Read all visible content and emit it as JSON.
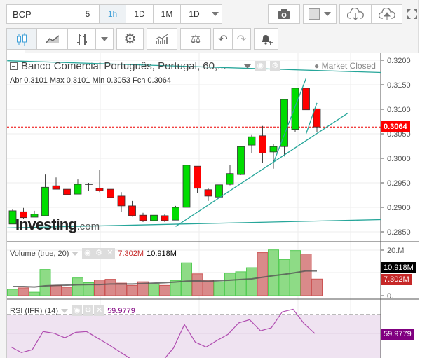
{
  "toolbar": {
    "symbol": "BCP",
    "intervals": [
      {
        "label": "5",
        "active": false
      },
      {
        "label": "1h",
        "active": true
      },
      {
        "label": "1D",
        "active": false
      },
      {
        "label": "1M",
        "active": false
      },
      {
        "label": "1D",
        "active": false
      }
    ],
    "icons": [
      "camera-icon",
      "color-picker-icon",
      "cloud-download-icon",
      "cloud-upload-icon",
      "fullscreen-icon",
      "candlestick-icon",
      "line-chart-icon",
      "bars-icon",
      "gear-icon",
      "indicators-icon",
      "scale-icon",
      "undo-icon",
      "redo-icon",
      "add-alert-icon"
    ]
  },
  "legend": {
    "title": "Banco Comercial Português, Portugal, 60,...",
    "market_status": "Market Closed",
    "ohlc": [
      {
        "k": "Abr",
        "v": "0.3101"
      },
      {
        "k": "Max",
        "v": "0.3101"
      },
      {
        "k": "Min",
        "v": "0.3053"
      },
      {
        "k": "Fch",
        "v": "0.3064"
      }
    ]
  },
  "watermark": {
    "brand": "Investing",
    "suffix": ".com"
  },
  "volume": {
    "label": "Volume (true, 20)",
    "value": "7.302M",
    "ma_value": "10.918M"
  },
  "rsi": {
    "label": "RSI (IFR) (14)",
    "value": "59.9779"
  },
  "colors": {
    "up": "#00dd00",
    "down": "#ff0000",
    "trend": "#26a69a",
    "rsi": "#b04cb0",
    "vol_up": "#8edb86",
    "vol_down": "#d98a8a"
  },
  "chart_data": {
    "type": "candlestick",
    "price_axis": {
      "ticks": [
        "0.3200",
        "0.3150",
        "0.3100",
        "0.3050",
        "0.3000",
        "0.2950",
        "0.2900",
        "0.2850"
      ],
      "range": [
        0.2835,
        0.3215
      ]
    },
    "last_price": "0.3064",
    "candles": [
      [
        0.2866,
        0.2897,
        0.2866,
        0.2893
      ],
      [
        0.2891,
        0.2899,
        0.2876,
        0.2879
      ],
      [
        0.288,
        0.2893,
        0.288,
        0.2886
      ],
      [
        0.2883,
        0.2967,
        0.2883,
        0.2941
      ],
      [
        0.2944,
        0.2961,
        0.2937,
        0.2937
      ],
      [
        0.2937,
        0.2954,
        0.2926,
        0.2926
      ],
      [
        0.2927,
        0.2957,
        0.2927,
        0.2947
      ],
      [
        0.2947,
        0.295,
        0.2934,
        0.2948
      ],
      [
        0.2939,
        0.2977,
        0.2931,
        0.2934
      ],
      [
        0.2937,
        0.2937,
        0.292,
        0.292
      ],
      [
        0.2923,
        0.2931,
        0.289,
        0.2903
      ],
      [
        0.2903,
        0.2913,
        0.2881,
        0.2883
      ],
      [
        0.2884,
        0.2889,
        0.287,
        0.2873
      ],
      [
        0.2873,
        0.2889,
        0.2856,
        0.2884
      ],
      [
        0.2883,
        0.2887,
        0.287,
        0.2873
      ],
      [
        0.2874,
        0.2903,
        0.2874,
        0.29
      ],
      [
        0.29,
        0.2986,
        0.29,
        0.2986
      ],
      [
        0.2984,
        0.2984,
        0.293,
        0.2939
      ],
      [
        0.2936,
        0.294,
        0.2913,
        0.2923
      ],
      [
        0.2921,
        0.2949,
        0.2911,
        0.2946
      ],
      [
        0.2947,
        0.2986,
        0.2945,
        0.2969
      ],
      [
        0.2967,
        0.3024,
        0.2966,
        0.3024
      ],
      [
        0.3027,
        0.3049,
        0.301,
        0.3044
      ],
      [
        0.3046,
        0.3066,
        0.2991,
        0.3011
      ],
      [
        0.3013,
        0.303,
        0.2979,
        0.3024
      ],
      [
        0.3024,
        0.312,
        0.3004,
        0.312
      ],
      [
        0.3059,
        0.3143,
        0.3053,
        0.3143
      ],
      [
        0.3143,
        0.3174,
        0.3063,
        0.3099
      ],
      [
        0.3101,
        0.3101,
        0.3053,
        0.3064
      ]
    ],
    "trendlines": [
      [
        [
          -0.5,
          0.3199
        ],
        [
          33.9,
          0.3175
        ]
      ],
      [
        [
          -0.5,
          0.2858
        ],
        [
          33.9,
          0.2875
        ]
      ],
      [
        [
          15,
          0.2861
        ],
        [
          30.9,
          0.3093
        ]
      ],
      [
        [
          24,
          0.2991
        ],
        [
          27,
          0.3163
        ]
      ],
      [
        [
          27,
          0.305
        ],
        [
          28,
          0.3113
        ]
      ]
    ],
    "volume_axis": {
      "ticks": [
        "20.M",
        "0."
      ],
      "range": [
        0,
        20
      ]
    },
    "volume_millions": [
      2.8,
      3.4,
      1.5,
      11.5,
      4.5,
      3.7,
      7.8,
      5.7,
      6.9,
      7.2,
      5.5,
      4.5,
      6.1,
      5.2,
      4.5,
      6.7,
      14.4,
      9.6,
      6.9,
      6.1,
      9.9,
      10.5,
      12.3,
      18.9,
      20.1,
      15.9,
      19.8,
      18.3,
      7.3
    ],
    "volume_ma_millions": [
      4.0,
      4.0,
      3.8,
      4.3,
      4.5,
      4.6,
      4.8,
      4.9,
      4.9,
      5.1,
      5.1,
      5.1,
      5.3,
      5.5,
      5.7,
      6.0,
      6.4,
      6.5,
      6.3,
      6.6,
      6.8,
      7.1,
      7.4,
      8.1,
      8.8,
      9.4,
      10.1,
      10.9,
      10.9
    ],
    "rsi_values": [
      53.0,
      49.9,
      51.4,
      61.0,
      60.1,
      57.7,
      60.6,
      61.0,
      57.6,
      54.2,
      50.5,
      46.8,
      43.1,
      43.0,
      45.5,
      52.3,
      64.7,
      55.4,
      52.8,
      56.3,
      59.5,
      65.6,
      67.3,
      61.4,
      63.0,
      71.4,
      72.8,
      65.3,
      59.98
    ],
    "rsi_levels": [
      70,
      30
    ]
  }
}
